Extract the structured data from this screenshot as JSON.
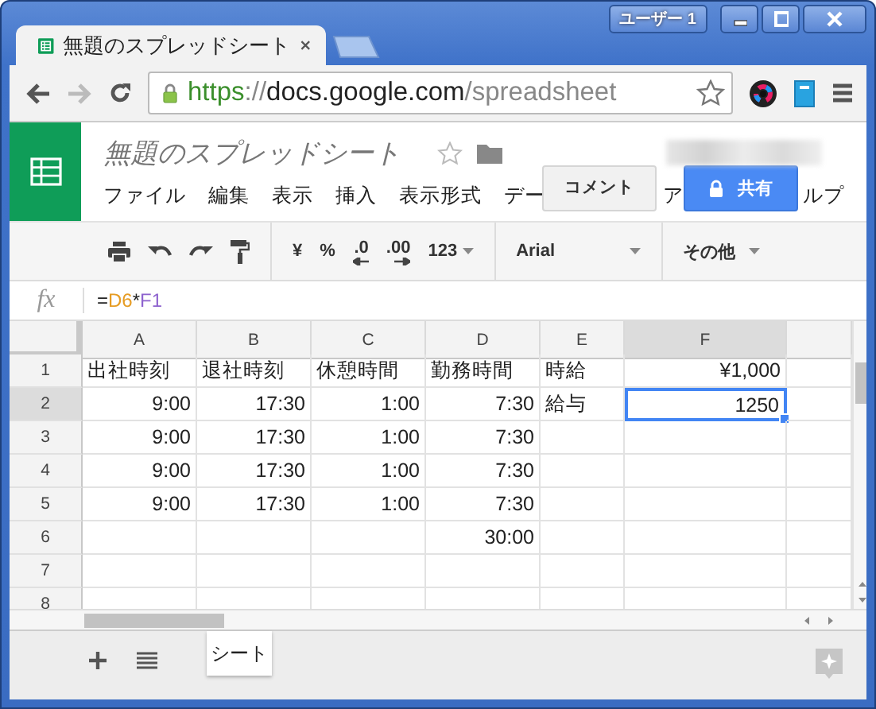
{
  "window": {
    "user": "ユーザー 1"
  },
  "tab": {
    "title": "無題のスプレッドシート",
    "selected": true
  },
  "address_bar": {
    "scheme": "https",
    "separator": "://",
    "host": "docs.google.com",
    "path": "/spreadsheet"
  },
  "doc": {
    "title": "無題のスプレッドシート",
    "starred": false
  },
  "menu": [
    "ファイル",
    "編集",
    "表示",
    "挿入",
    "表示形式",
    "デー",
    "ア",
    "ルプ"
  ],
  "buttons": {
    "comment": "コメント",
    "share": "共有"
  },
  "toolbar": {
    "currency": "¥",
    "percent": "%",
    "decrease_decimals": ".0",
    "increase_decimals": ".00",
    "number_format": "123",
    "font": "Arial",
    "more": "その他"
  },
  "formula_bar": {
    "label": "fx",
    "parts": [
      {
        "text": "=",
        "color": "#222222"
      },
      {
        "text": "D6",
        "color": "#e69c24"
      },
      {
        "text": "*",
        "color": "#222222"
      },
      {
        "text": "F1",
        "color": "#8e63ce"
      }
    ]
  },
  "table": {
    "columns": [
      {
        "label": "A",
        "selected": false
      },
      {
        "label": "B",
        "selected": false
      },
      {
        "label": "C",
        "selected": false
      },
      {
        "label": "D",
        "selected": false
      },
      {
        "label": "E",
        "selected": false
      },
      {
        "label": "F",
        "selected": true
      }
    ],
    "rows": [
      {
        "number": "1",
        "selected": false,
        "cells": [
          {
            "text": "出社時刻",
            "kind": "text"
          },
          {
            "text": "退社時刻",
            "kind": "text"
          },
          {
            "text": "休憩時間",
            "kind": "text"
          },
          {
            "text": "勤務時間",
            "kind": "text"
          },
          {
            "text": "時給",
            "kind": "text"
          },
          {
            "text": "¥1,000",
            "kind": "number"
          }
        ]
      },
      {
        "number": "2",
        "selected": true,
        "cells": [
          {
            "text": "9:00",
            "kind": "number"
          },
          {
            "text": "17:30",
            "kind": "number"
          },
          {
            "text": "1:00",
            "kind": "number"
          },
          {
            "text": "7:30",
            "kind": "number"
          },
          {
            "text": "給与",
            "kind": "text"
          },
          {
            "text": "1250",
            "kind": "number"
          }
        ]
      },
      {
        "number": "3",
        "selected": false,
        "cells": [
          {
            "text": "9:00",
            "kind": "number"
          },
          {
            "text": "17:30",
            "kind": "number"
          },
          {
            "text": "1:00",
            "kind": "number"
          },
          {
            "text": "7:30",
            "kind": "number"
          },
          null,
          null
        ]
      },
      {
        "number": "4",
        "selected": false,
        "cells": [
          {
            "text": "9:00",
            "kind": "number"
          },
          {
            "text": "17:30",
            "kind": "number"
          },
          {
            "text": "1:00",
            "kind": "number"
          },
          {
            "text": "7:30",
            "kind": "number"
          },
          null,
          null
        ]
      },
      {
        "number": "5",
        "selected": false,
        "cells": [
          {
            "text": "9:00",
            "kind": "number"
          },
          {
            "text": "17:30",
            "kind": "number"
          },
          {
            "text": "1:00",
            "kind": "number"
          },
          {
            "text": "7:30",
            "kind": "number"
          },
          null,
          null
        ]
      },
      {
        "number": "6",
        "selected": false,
        "cells": [
          null,
          null,
          null,
          {
            "text": "30:00",
            "kind": "number"
          },
          null,
          null
        ]
      },
      {
        "number": "7",
        "selected": false,
        "cells": [
          null,
          null,
          null,
          null,
          null,
          null
        ]
      },
      {
        "number": "8",
        "selected": false,
        "cells": [
          null,
          null,
          null,
          null,
          null,
          null
        ]
      }
    ]
  },
  "sheets": [
    {
      "label": "シート",
      "selected": true
    }
  ]
}
